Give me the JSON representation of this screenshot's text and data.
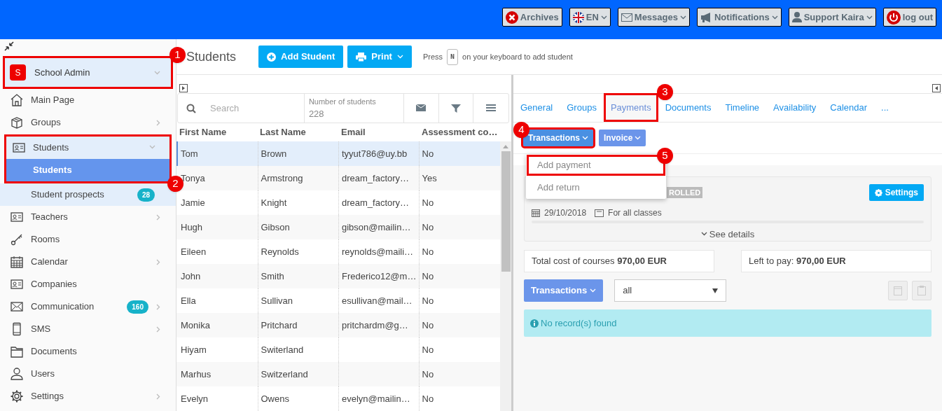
{
  "topbar": {
    "buttons": [
      {
        "kind": "archives",
        "label": "Archives",
        "caret": false
      },
      {
        "kind": "language",
        "label": "EN",
        "caret": true
      },
      {
        "kind": "messages",
        "label": "Messages",
        "caret": true
      },
      {
        "kind": "notifications",
        "label": "Notifications",
        "caret": true
      },
      {
        "kind": "user",
        "label": "Support Kaira",
        "caret": true
      },
      {
        "kind": "logout",
        "label": "log out",
        "caret": false
      }
    ]
  },
  "sidebar": {
    "account": {
      "initial": "S",
      "name": "School Admin"
    },
    "items": [
      {
        "label": "Main Page",
        "has_children": false,
        "expanded": false
      },
      {
        "label": "Groups",
        "has_children": true,
        "expanded": false
      },
      {
        "label": "Students",
        "has_children": true,
        "expanded": true,
        "children": [
          {
            "label": "Students",
            "selected": true
          },
          {
            "label": "Student prospects",
            "selected": false,
            "badge": "28"
          }
        ]
      },
      {
        "label": "Teachers",
        "has_children": true,
        "expanded": false
      },
      {
        "label": "Rooms",
        "has_children": false,
        "expanded": false
      },
      {
        "label": "Calendar",
        "has_children": true,
        "expanded": false
      },
      {
        "label": "Companies",
        "has_children": false,
        "expanded": false
      },
      {
        "label": "Communication",
        "has_children": true,
        "expanded": false,
        "badge": "160"
      },
      {
        "label": "SMS",
        "has_children": true,
        "expanded": false
      },
      {
        "label": "Documents",
        "has_children": false,
        "expanded": false
      },
      {
        "label": "Users",
        "has_children": false,
        "expanded": false
      },
      {
        "label": "Settings",
        "has_children": true,
        "expanded": false
      }
    ]
  },
  "header": {
    "title": "Students",
    "add_button": "Add Student",
    "print_button": "Print",
    "hint_before": "Press",
    "hint_key": "N",
    "hint_after": "on your keyboard to add student"
  },
  "table": {
    "search_placeholder": "Search",
    "count_label": "Number of students",
    "count": "228",
    "columns": [
      "First Name",
      "Last Name",
      "Email",
      "Assessment co…"
    ],
    "rows": [
      {
        "cells": [
          "Tom",
          "Brown",
          "tyyut786@uy.bb",
          "No"
        ],
        "selected": true
      },
      {
        "cells": [
          "Tonya",
          "Armstrong",
          "dream_factory…",
          "Yes"
        ],
        "selected": false
      },
      {
        "cells": [
          "Jamie",
          "Knight",
          "dream_factory…",
          "No"
        ],
        "selected": false
      },
      {
        "cells": [
          "Hugh",
          "Gibson",
          "gibson@mailin…",
          "No"
        ],
        "selected": false
      },
      {
        "cells": [
          "Eileen",
          "Reynolds",
          "reynolds@maili…",
          "No"
        ],
        "selected": false
      },
      {
        "cells": [
          "John",
          "Smith",
          "Frederico12@m…",
          "No"
        ],
        "selected": false
      },
      {
        "cells": [
          "Ella",
          "Sullivan",
          "esullivan@mail…",
          "No"
        ],
        "selected": false
      },
      {
        "cells": [
          "Monika",
          "Pritchard",
          "pritchardm@g…",
          "No"
        ],
        "selected": false
      },
      {
        "cells": [
          "Hiyam",
          "Switerland",
          "",
          "No"
        ],
        "selected": false
      },
      {
        "cells": [
          "Marhus",
          "Switzerland",
          "",
          "No"
        ],
        "selected": false
      },
      {
        "cells": [
          "Evelyn",
          "Owens",
          "evelyn@mailin…",
          "No"
        ],
        "selected": false
      }
    ]
  },
  "detail": {
    "tabs": [
      {
        "label": "General",
        "selected": false
      },
      {
        "label": "Groups",
        "selected": false
      },
      {
        "label": "Payments",
        "selected": true
      },
      {
        "label": "Documents",
        "selected": false
      },
      {
        "label": "Timeline",
        "selected": false
      },
      {
        "label": "Availability",
        "selected": false
      },
      {
        "label": "Calendar",
        "selected": false
      },
      {
        "label": "...",
        "selected": false
      }
    ],
    "action_buttons": [
      {
        "label": "Transactions",
        "expanded": true
      },
      {
        "label": "Invoice",
        "expanded": false
      }
    ],
    "menu": [
      "Add payment",
      "Add return"
    ],
    "enrollment": {
      "status": "ROLLED",
      "settings_button": "Settings",
      "date": "29/10/2018",
      "scope": "For all classes",
      "details_link": "See details"
    },
    "total_cost": "Total cost of courses **970,00 EUR**",
    "left_to_pay": "Left to pay: **970,00 EUR**",
    "transactions_button": "Transactions",
    "filter_value": "all",
    "empty_message": "No record(s) found"
  },
  "annotations": [
    "1",
    "2",
    "3",
    "4",
    "5"
  ]
}
